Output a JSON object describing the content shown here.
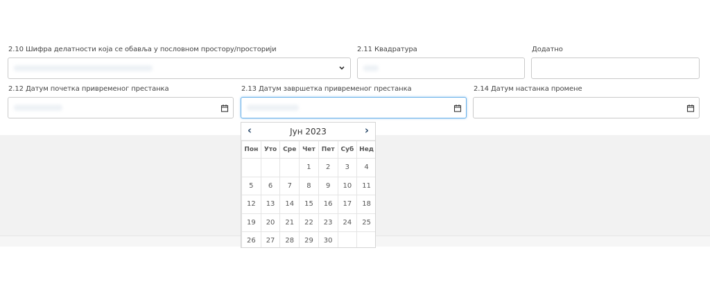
{
  "form": {
    "activity_code": {
      "label": "2.10 Шифра делатности која се обавља у пословном простору/просторији"
    },
    "area": {
      "label": "2.11 Квадратура"
    },
    "additional": {
      "label": "Додатно"
    },
    "start_date": {
      "label": "2.12 Датум почетка привременог престанка"
    },
    "end_date": {
      "label": "2.13 Датум завршетка привременог престанка"
    },
    "change_date": {
      "label": "2.14 Датум настанка промене"
    }
  },
  "datepicker": {
    "prev_icon": "chevron-left-icon",
    "next_icon": "chevron-right-icon",
    "prev": "‹",
    "next": "›",
    "title": "Јун 2023",
    "weekdays": [
      "Пон",
      "Уто",
      "Сре",
      "Чет",
      "Пет",
      "Суб",
      "Нед"
    ],
    "weeks": [
      [
        "",
        "",
        "",
        "1",
        "2",
        "3",
        "4"
      ],
      [
        "5",
        "6",
        "7",
        "8",
        "9",
        "10",
        "11"
      ],
      [
        "12",
        "13",
        "14",
        "15",
        "16",
        "17",
        "18"
      ],
      [
        "19",
        "20",
        "21",
        "22",
        "23",
        "24",
        "25"
      ],
      [
        "26",
        "27",
        "28",
        "29",
        "30",
        "",
        ""
      ]
    ]
  },
  "colors": {
    "focus_border": "#66afe9",
    "nav_arrow": "#2c4a6b",
    "background_band": "#f2f2f2"
  }
}
